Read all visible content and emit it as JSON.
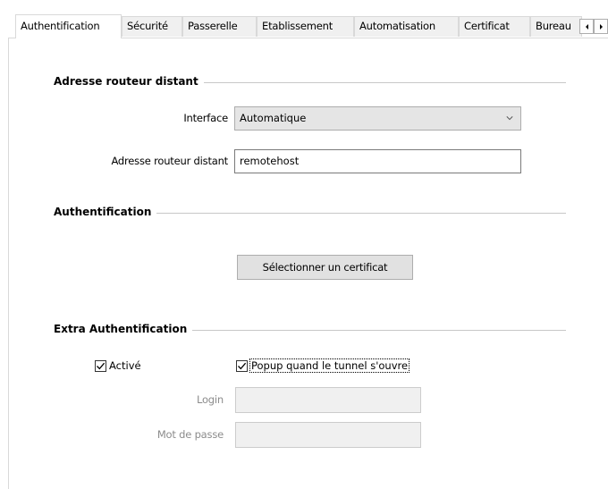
{
  "tabs": [
    {
      "label": "Authentification",
      "active": true
    },
    {
      "label": "Sécurité",
      "active": false
    },
    {
      "label": "Passerelle",
      "active": false
    },
    {
      "label": "Etablissement",
      "active": false
    },
    {
      "label": "Automatisation",
      "active": false
    },
    {
      "label": "Certificat",
      "active": false
    },
    {
      "label": "Bureau",
      "active": false
    }
  ],
  "remote_router": {
    "title": "Adresse routeur distant",
    "interface_label": "Interface",
    "interface_value": "Automatique",
    "address_label": "Adresse routeur distant",
    "address_value": "remotehost"
  },
  "authentication": {
    "title": "Authentification",
    "select_certificate_label": "Sélectionner un certificat"
  },
  "extra_authentication": {
    "title": "Extra Authentification",
    "enabled_label": "Activé",
    "enabled_checked": true,
    "popup_label": "Popup quand le tunnel s'ouvre",
    "popup_checked": true,
    "login_label": "Login",
    "login_value": "",
    "password_label": "Mot de passe",
    "password_value": ""
  },
  "colors": {
    "tab_inactive_bg": "#f0f0f0",
    "control_bg": "#e1e1e1",
    "disabled_text": "#8c8c8c"
  }
}
